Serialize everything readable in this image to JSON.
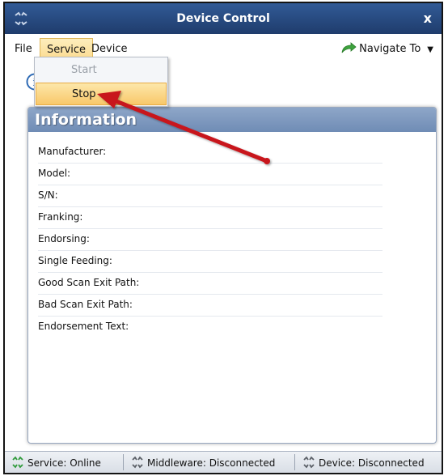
{
  "window": {
    "title": "Device Control",
    "close_label": "x"
  },
  "menubar": {
    "file": "File",
    "service": "Service",
    "device": "Device",
    "navigate": "Navigate To",
    "navigate_caret": "▼"
  },
  "dropdown": {
    "start": "Start",
    "stop": "Stop"
  },
  "panel": {
    "title": "Information",
    "fields": [
      "Manufacturer:",
      "Model:",
      "S/N:",
      "Franking:",
      "Endorsing:",
      "Single Feeding:",
      "Good Scan Exit Path:",
      "Bad Scan Exit Path:",
      "Endorsement Text:"
    ]
  },
  "statusbar": {
    "service": "Service: Online",
    "middleware": "Middleware: Disconnected",
    "device": "Device: Disconnected"
  },
  "colors": {
    "title_bar": "#1f3c6c",
    "menu_highlight": "#fbd88a",
    "annotation_arrow": "#c8161d",
    "status_online": "#2e9a3a"
  },
  "icons": [
    "app-logo-icon",
    "close-icon",
    "navigate-arrow-icon",
    "info-icon",
    "service-status-icon",
    "middleware-status-icon",
    "device-status-icon"
  ]
}
